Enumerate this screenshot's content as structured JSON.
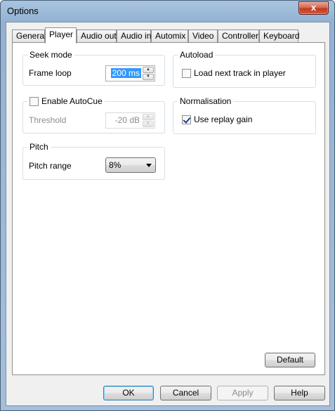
{
  "window": {
    "title": "Options",
    "close_label": "x"
  },
  "tabs": [
    {
      "label": "General"
    },
    {
      "label": "Player"
    },
    {
      "label": "Audio out"
    },
    {
      "label": "Audio in"
    },
    {
      "label": "Automix"
    },
    {
      "label": "Video"
    },
    {
      "label": "Controller"
    },
    {
      "label": "Keyboard"
    }
  ],
  "active_tab": "Player",
  "seek_mode": {
    "title": "Seek mode",
    "frame_loop_label": "Frame loop",
    "frame_loop_value": "200 ms"
  },
  "autocue": {
    "title": "Enable AutoCue",
    "checked": false,
    "threshold_label": "Threshold",
    "threshold_value": "-20 dB"
  },
  "pitch": {
    "title": "Pitch",
    "range_label": "Pitch range",
    "range_value": "8%"
  },
  "autoload": {
    "title": "Autoload",
    "load_next_label": "Load next track in player",
    "checked": false
  },
  "normalisation": {
    "title": "Normalisation",
    "replay_gain_label": "Use replay gain",
    "checked": true
  },
  "buttons": {
    "default": "Default",
    "ok": "OK",
    "cancel": "Cancel",
    "apply": "Apply",
    "help": "Help"
  }
}
